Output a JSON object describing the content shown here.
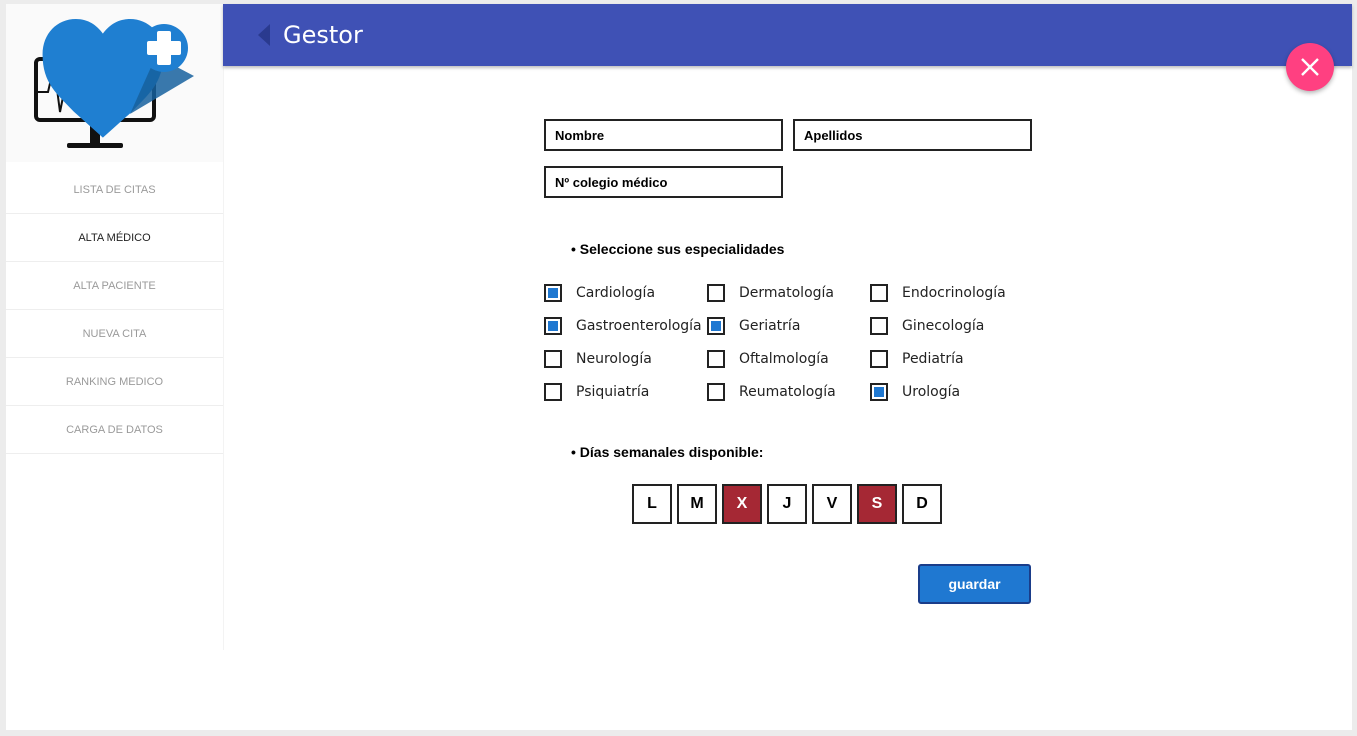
{
  "header": {
    "title": "Gestor"
  },
  "sidebar": {
    "items": [
      {
        "label": "LISTA DE CITAS",
        "active": false
      },
      {
        "label": "ALTA MÉDICO",
        "active": true
      },
      {
        "label": "ALTA PACIENTE",
        "active": false
      },
      {
        "label": "NUEVA CITA",
        "active": false
      },
      {
        "label": "RANKING MEDICO",
        "active": false
      },
      {
        "label": "CARGA DE DATOS",
        "active": false
      }
    ]
  },
  "form": {
    "nombre_placeholder": "Nombre",
    "apellidos_placeholder": "Apellidos",
    "colegio_placeholder": "Nº colegio médico",
    "specialties_label": "• Seleccione sus especialidades",
    "specialties": [
      {
        "label": "Cardiología",
        "checked": true
      },
      {
        "label": "Dermatología",
        "checked": false
      },
      {
        "label": "Endocrinología",
        "checked": false
      },
      {
        "label": "Gastroenterología",
        "checked": true
      },
      {
        "label": "Geriatría",
        "checked": true
      },
      {
        "label": "Ginecología",
        "checked": false
      },
      {
        "label": "Neurología",
        "checked": false
      },
      {
        "label": "Oftalmología",
        "checked": false
      },
      {
        "label": "Pediatría",
        "checked": false
      },
      {
        "label": "Psiquiatría",
        "checked": false
      },
      {
        "label": "Reumatología",
        "checked": false
      },
      {
        "label": "Urología",
        "checked": true
      }
    ],
    "days_label": "• Días semanales disponible:",
    "days": [
      {
        "label": "L",
        "selected": false
      },
      {
        "label": "M",
        "selected": false
      },
      {
        "label": "X",
        "selected": true
      },
      {
        "label": "J",
        "selected": false
      },
      {
        "label": "V",
        "selected": false
      },
      {
        "label": "S",
        "selected": true
      },
      {
        "label": "D",
        "selected": false
      }
    ],
    "save_label": "guardar"
  },
  "colors": {
    "header": "#3f51b5",
    "fab": "#ff4081",
    "checkbox": "#1f78d1",
    "day_selected": "#a52834",
    "button": "#1f78d1"
  },
  "icons": {
    "logo": "heart-monitor-logo",
    "back": "back-arrow-icon",
    "close": "close-icon"
  }
}
